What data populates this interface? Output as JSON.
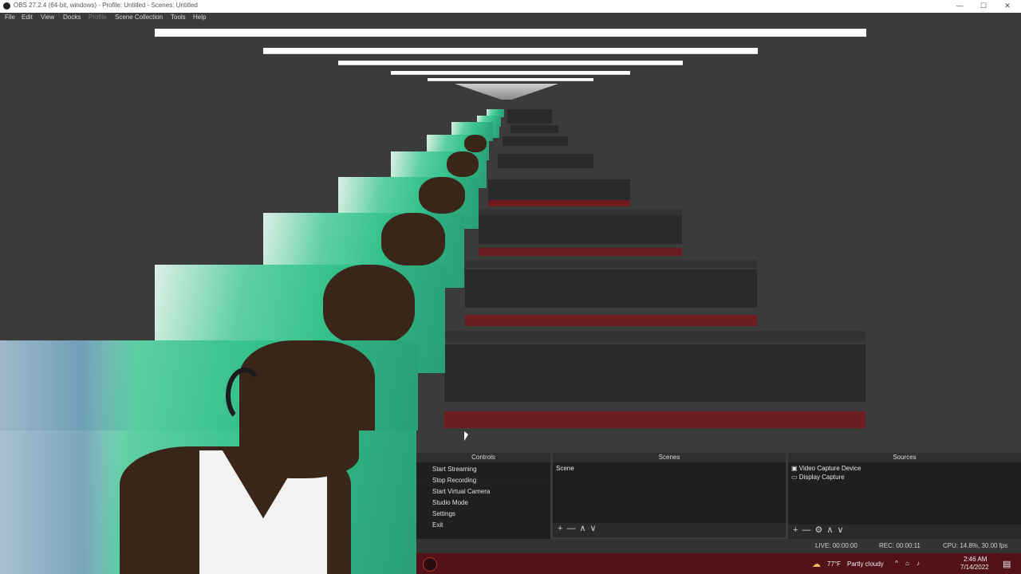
{
  "window": {
    "title": "OBS 27.2.4 (64-bit, windows) - Profile: Untitled - Scenes: Untitled",
    "minimize": "—",
    "maximize": "☐",
    "close": "✕"
  },
  "menu": {
    "items": [
      "File",
      "Edit",
      "View",
      "Docks",
      "Profile",
      "Scene Collection",
      "Tools",
      "Help"
    ]
  },
  "docks": {
    "controls": {
      "title": "Controls",
      "items": [
        "Start Streaming",
        "Stop Recording",
        "Start Virtual Camera",
        "Studio Mode",
        "Settings",
        "Exit"
      ]
    },
    "scenes": {
      "title": "Scenes",
      "items": [
        "Scene"
      ],
      "tools": [
        "+",
        "—",
        "∧",
        "∨"
      ]
    },
    "sources": {
      "title": "Sources",
      "items": [
        "Video Capture Device",
        "Display Capture"
      ],
      "tools": [
        "+",
        "—",
        "⚙",
        "∧",
        "∨"
      ]
    }
  },
  "status": {
    "cpu": "CPU: 14.8%, 30.00 fps",
    "rec": "REC: 00:00:11",
    "live": "LIVE: 00:00:00"
  },
  "taskbar": {
    "weather": "77°F",
    "weather_desc": "Partly cloudy",
    "time": "2:46 AM",
    "date": "7/14/2022"
  },
  "colors": {
    "accent_red": "#521218",
    "dock_bg": "#1f1f1f",
    "window_bg": "#3b3b3b",
    "screen_green": "#33c08c"
  }
}
